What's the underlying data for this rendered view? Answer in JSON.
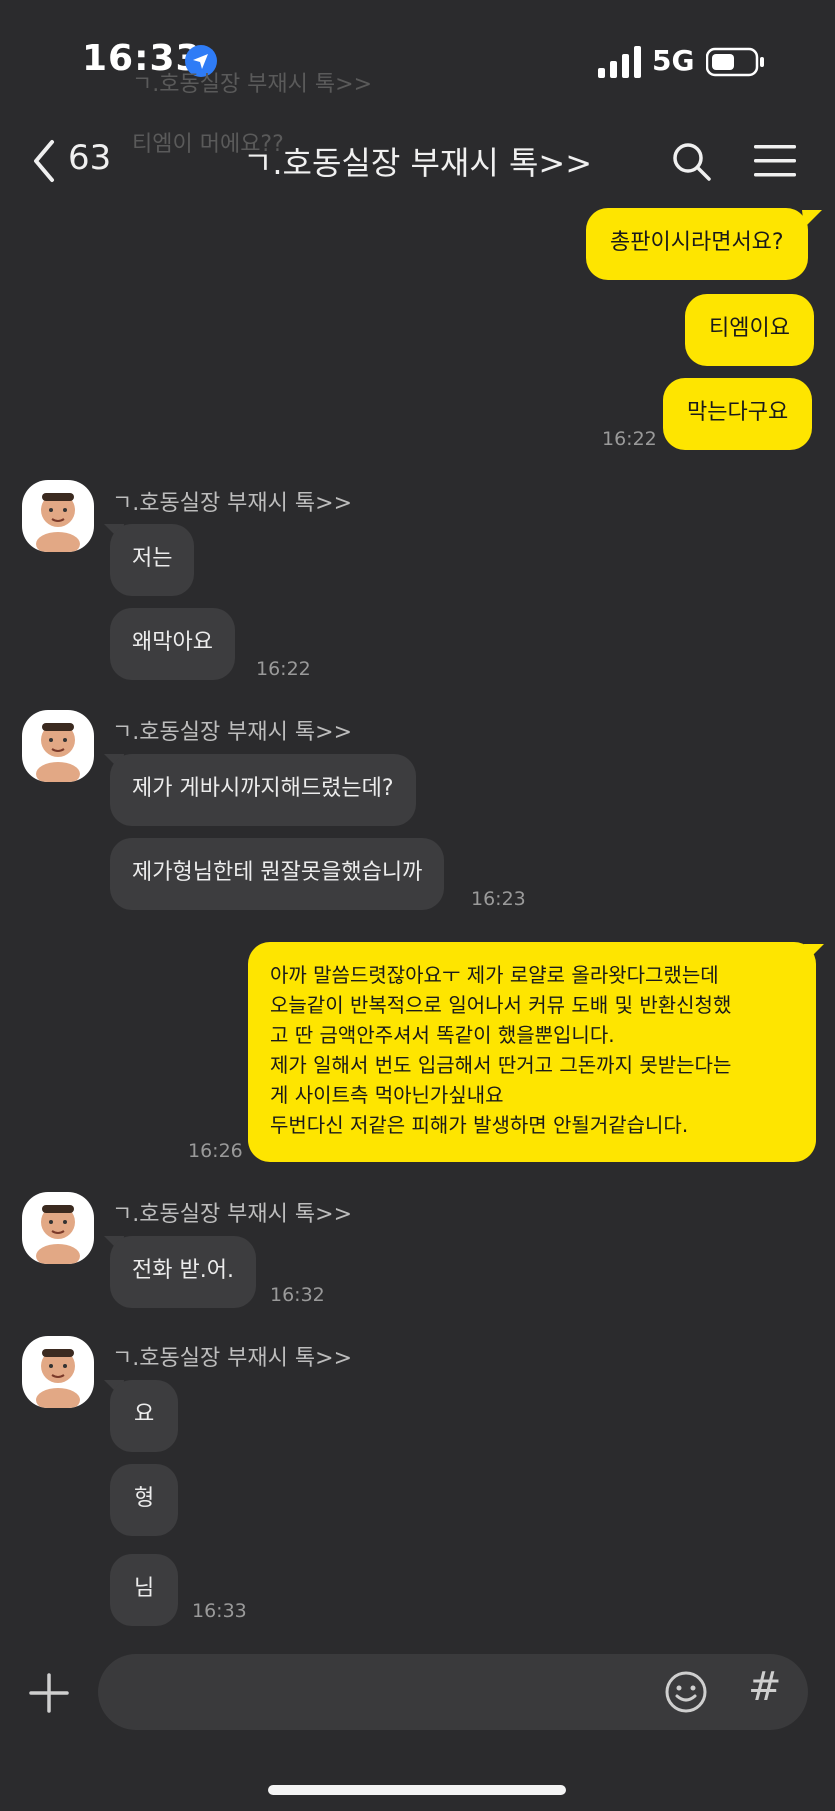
{
  "status": {
    "time": "16:33",
    "network": "5G"
  },
  "ghost": {
    "sender": "ㄱ.호동실장 부재시 톡>>",
    "text": "티엠이 머에요??"
  },
  "nav": {
    "count": "63",
    "title": "ㄱ.호동실장 부재시 톡>>"
  },
  "messages": {
    "m1": "총판이시라면서요?",
    "m2": "티엠이요",
    "m3": "막는다구요",
    "t1": "16:22",
    "s1": "ㄱ.호동실장 부재시 톡>>",
    "m4": "저는",
    "m5": "왜막아요",
    "t2": "16:22",
    "s2": "ㄱ.호동실장 부재시 톡>>",
    "m6": "제가 게바시까지해드렸는데?",
    "m7": "제가형님한테 뭔잘못을했습니까",
    "t3": "16:23",
    "m8_lines": [
      "아까 말씀드렷잖아요ㅜ 제가 로얄로 올라왓다그랬는데",
      "오늘같이 반복적으로 일어나서 커뮤 도배 및 반환신청했",
      "고 딴 금액안주셔서 똑같이 했을뿐입니다.",
      "제가 일해서 번도 입금해서 딴거고 그돈까지 못받는다는",
      "게 사이트측 먹아닌가싶내요",
      "두번다신 저같은 피해가 발생하면 안될거같습니다."
    ],
    "t4": "16:26",
    "s3": "ㄱ.호동실장 부재시 톡>>",
    "m9": "전화 받.어.",
    "t5": "16:32",
    "s4": "ㄱ.호동실장 부재시 톡>>",
    "m10": "요",
    "m11": "형",
    "m12": "님",
    "t6": "16:33"
  },
  "colors": {
    "my_bubble": "#fee500",
    "their_bubble": "#3d3d3f",
    "background": "#2b2b2d"
  },
  "icons": [
    "location-arrow-icon",
    "signal-icon",
    "battery-icon",
    "back-chevron-icon",
    "search-icon",
    "menu-icon",
    "plus-icon",
    "emoji-icon",
    "hash-icon"
  ]
}
